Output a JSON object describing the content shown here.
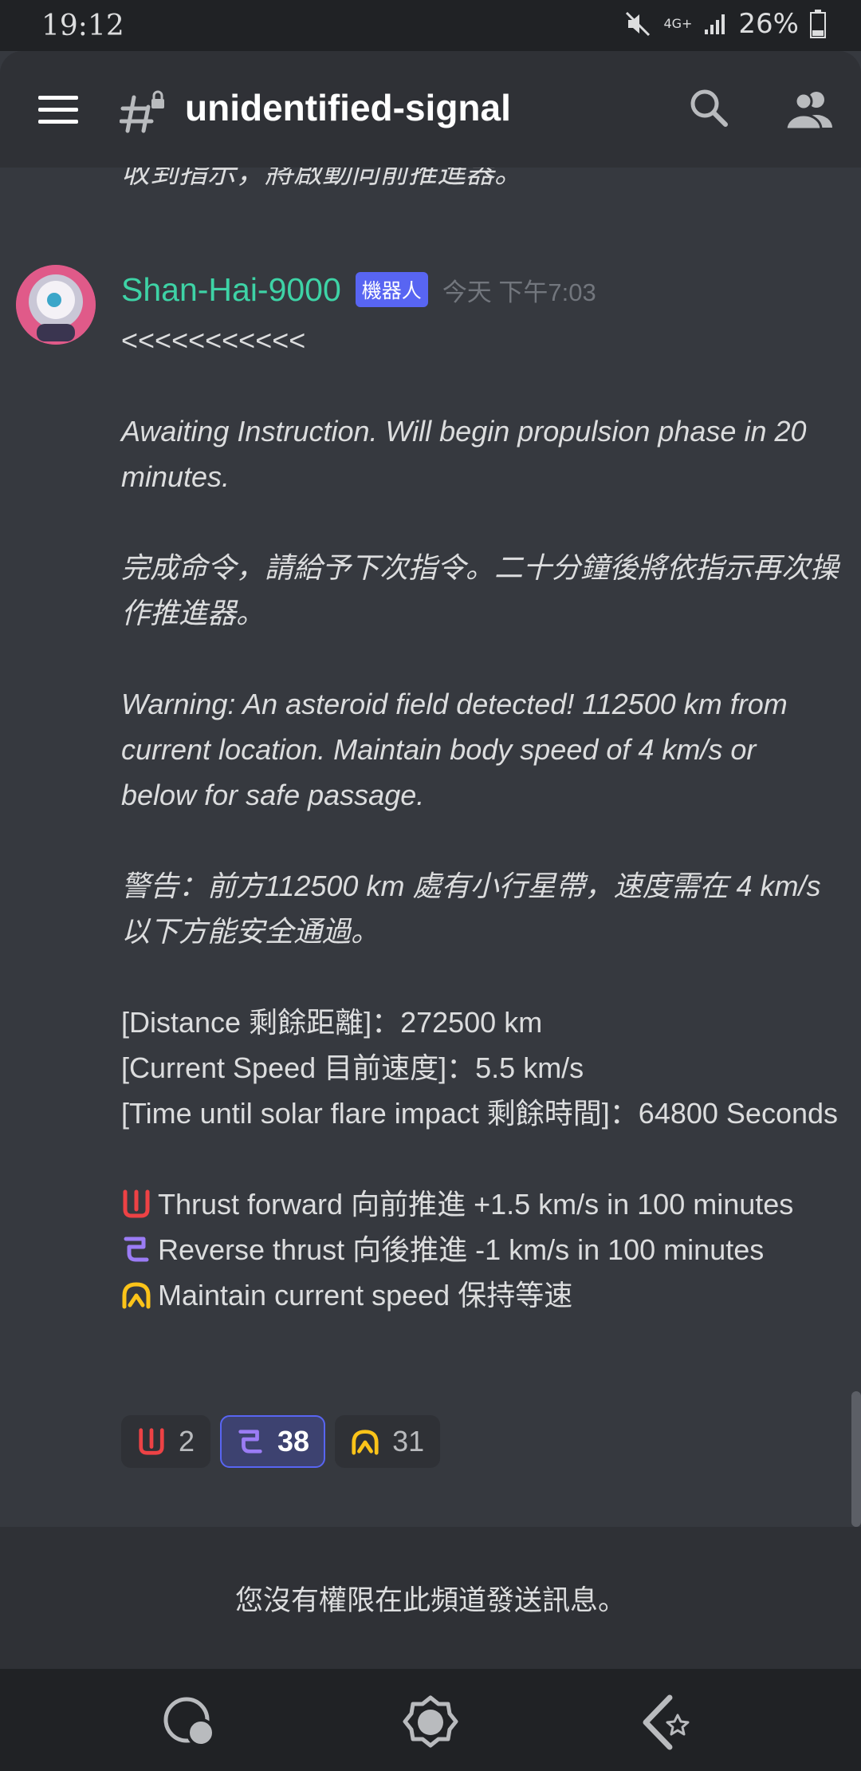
{
  "status_bar": {
    "time": "19:12",
    "network": "4G+",
    "battery": "26%",
    "icons": [
      "mute-icon",
      "signal-icon",
      "battery-icon"
    ]
  },
  "header": {
    "channel_name": "unidentified-signal",
    "icons": [
      "menu-icon",
      "locked-channel-icon",
      "search-icon",
      "members-icon"
    ]
  },
  "previous_message": {
    "text": "收到指示，將啟動向前推進器。"
  },
  "message": {
    "author": "Shan-Hai-9000",
    "author_color": "#3ed3a6",
    "bot_tag": "機器人",
    "timestamp": "今天 下午7:03",
    "lines": {
      "arrows": "<<<<<<<<<<<",
      "await_en": "Awaiting Instruction. Will begin propulsion phase in 20 minutes.",
      "await_zh": "完成命令，請給予下次指令。二十分鐘後將依指示再次操作推進器。",
      "warn_en": "Warning: An asteroid field detected! 112500 km from current location. Maintain body speed of 4 km/s or below for safe passage.",
      "warn_zh": "警告：前方112500 km 處有小行星帶，速度需在 4 km/s 以下方能安全通過。",
      "distance": "[Distance 剩餘距離]：272500 km",
      "speed": "[Current Speed 目前速度]：5.5 km/s",
      "time_left": "[Time until solar flare impact 剩餘時間]：64800 Seconds",
      "opt_forward": "Thrust forward 向前推進  +1.5 km/s in 100 minutes",
      "opt_reverse": "Reverse thrust 向後推進 -1 km/s in 100 minutes",
      "opt_maintain": "Maintain current speed 保持等速"
    }
  },
  "reactions": [
    {
      "emoji": "forward-glyph-icon",
      "count": "2",
      "color": "#ed4245",
      "active": false
    },
    {
      "emoji": "reverse-glyph-icon",
      "count": "38",
      "color": "#9b7cf5",
      "active": true
    },
    {
      "emoji": "maintain-glyph-icon",
      "count": "31",
      "color": "#fcc419",
      "active": false
    }
  ],
  "footer": {
    "no_permission": "您沒有權限在此頻道發送訊息。"
  },
  "bottom_nav": [
    "recent-apps-icon",
    "home-icon",
    "back-icon"
  ]
}
